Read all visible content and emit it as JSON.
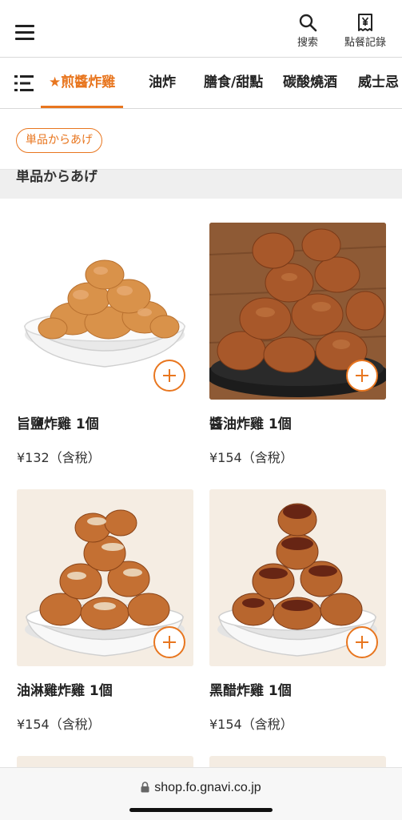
{
  "header": {
    "search_label": "搜索",
    "order_history_label": "點餐記錄"
  },
  "tabs": [
    {
      "label": "★煎醬炸雞",
      "active": true
    },
    {
      "label": "油炸",
      "active": false
    },
    {
      "label": "膳食/甜點",
      "active": false
    },
    {
      "label": "碳酸燒酒",
      "active": false
    },
    {
      "label": "威士忌",
      "active": false
    }
  ],
  "filter": {
    "chip_label": "単品からあげ"
  },
  "section": {
    "title": "単品からあげ"
  },
  "products": [
    {
      "name": "旨鹽炸雞 1個",
      "price": "¥132（含稅）"
    },
    {
      "name": "醬油炸雞 1個",
      "price": "¥154（含稅）"
    },
    {
      "name": "油淋雞炸雞 1個",
      "price": "¥154（含稅）"
    },
    {
      "name": "黑醋炸雞 1個",
      "price": "¥154（含稅）"
    }
  ],
  "browser": {
    "url": "shop.fo.gnavi.co.jp"
  },
  "colors": {
    "accent": "#e8761f",
    "divider": "#d9d9d9",
    "section_bg": "#efefef"
  }
}
